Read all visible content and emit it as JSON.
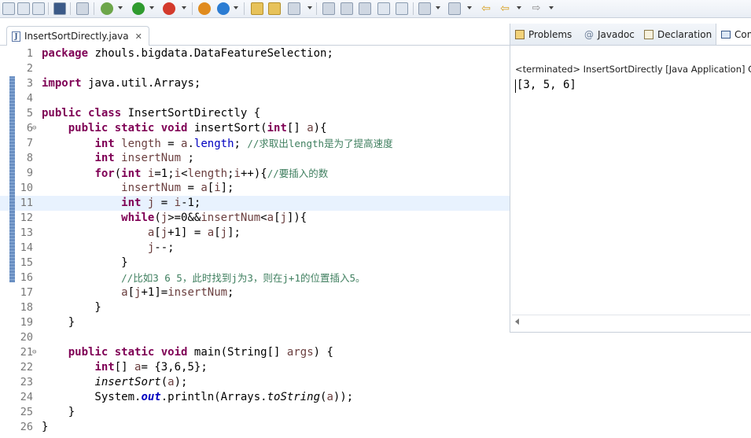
{
  "editor": {
    "tab_label": "InsertSortDirectly.java",
    "lines": [
      {
        "num": "1",
        "tokens": [
          {
            "t": "package",
            "c": "kw"
          },
          {
            "t": " zhouls.bigdata.DataFeatureSelection;"
          }
        ]
      },
      {
        "num": "2",
        "tokens": []
      },
      {
        "num": "3",
        "tokens": [
          {
            "t": "import",
            "c": "kw"
          },
          {
            "t": " java.util.Arrays;"
          }
        ]
      },
      {
        "num": "4",
        "tokens": []
      },
      {
        "num": "5",
        "tokens": [
          {
            "t": "public",
            "c": "kw"
          },
          {
            "t": " "
          },
          {
            "t": "class",
            "c": "kw"
          },
          {
            "t": " InsertSortDirectly {"
          }
        ]
      },
      {
        "num": "6",
        "fold": true,
        "tokens": [
          {
            "t": "    "
          },
          {
            "t": "public",
            "c": "kw"
          },
          {
            "t": " "
          },
          {
            "t": "static",
            "c": "kw"
          },
          {
            "t": " "
          },
          {
            "t": "void",
            "c": "kw"
          },
          {
            "t": " insertSort("
          },
          {
            "t": "int",
            "c": "kw"
          },
          {
            "t": "[] "
          },
          {
            "t": "a",
            "c": "var"
          },
          {
            "t": "){"
          }
        ]
      },
      {
        "num": "7",
        "tokens": [
          {
            "t": "        "
          },
          {
            "t": "int",
            "c": "kw"
          },
          {
            "t": " "
          },
          {
            "t": "length",
            "c": "var"
          },
          {
            "t": " = "
          },
          {
            "t": "a",
            "c": "var"
          },
          {
            "t": "."
          },
          {
            "t": "length",
            "c": "field"
          },
          {
            "t": "; "
          },
          {
            "t": "//求取出length是为了提高速度",
            "c": "cm"
          }
        ]
      },
      {
        "num": "8",
        "tokens": [
          {
            "t": "        "
          },
          {
            "t": "int",
            "c": "kw"
          },
          {
            "t": " "
          },
          {
            "t": "insertNum",
            "c": "var"
          },
          {
            "t": " ;"
          }
        ]
      },
      {
        "num": "9",
        "tokens": [
          {
            "t": "        "
          },
          {
            "t": "for",
            "c": "kw"
          },
          {
            "t": "("
          },
          {
            "t": "int",
            "c": "kw"
          },
          {
            "t": " "
          },
          {
            "t": "i",
            "c": "var"
          },
          {
            "t": "=1;"
          },
          {
            "t": "i",
            "c": "var"
          },
          {
            "t": "<"
          },
          {
            "t": "length",
            "c": "var"
          },
          {
            "t": ";"
          },
          {
            "t": "i",
            "c": "var"
          },
          {
            "t": "++){"
          },
          {
            "t": "//要插入的数",
            "c": "cm"
          }
        ]
      },
      {
        "num": "10",
        "tokens": [
          {
            "t": "            "
          },
          {
            "t": "insertNum",
            "c": "var"
          },
          {
            "t": " = "
          },
          {
            "t": "a",
            "c": "var"
          },
          {
            "t": "["
          },
          {
            "t": "i",
            "c": "var"
          },
          {
            "t": "];"
          }
        ]
      },
      {
        "num": "11",
        "current": true,
        "tokens": [
          {
            "t": "            "
          },
          {
            "t": "int",
            "c": "kw"
          },
          {
            "t": " "
          },
          {
            "t": "j",
            "c": "var"
          },
          {
            "t": " = "
          },
          {
            "t": "i",
            "c": "var"
          },
          {
            "t": "-1;"
          }
        ]
      },
      {
        "num": "12",
        "tokens": [
          {
            "t": "            "
          },
          {
            "t": "while",
            "c": "kw"
          },
          {
            "t": "("
          },
          {
            "t": "j",
            "c": "var"
          },
          {
            "t": ">=0&&"
          },
          {
            "t": "insertNum",
            "c": "var"
          },
          {
            "t": "<"
          },
          {
            "t": "a",
            "c": "var"
          },
          {
            "t": "["
          },
          {
            "t": "j",
            "c": "var"
          },
          {
            "t": "]){"
          }
        ]
      },
      {
        "num": "13",
        "tokens": [
          {
            "t": "                "
          },
          {
            "t": "a",
            "c": "var"
          },
          {
            "t": "["
          },
          {
            "t": "j",
            "c": "var"
          },
          {
            "t": "+1] = "
          },
          {
            "t": "a",
            "c": "var"
          },
          {
            "t": "["
          },
          {
            "t": "j",
            "c": "var"
          },
          {
            "t": "];"
          }
        ]
      },
      {
        "num": "14",
        "tokens": [
          {
            "t": "                "
          },
          {
            "t": "j",
            "c": "var"
          },
          {
            "t": "--;"
          }
        ]
      },
      {
        "num": "15",
        "tokens": [
          {
            "t": "            }"
          }
        ]
      },
      {
        "num": "16",
        "tokens": [
          {
            "t": "            "
          },
          {
            "t": "//比如3 6 5，此时找到j为3，则在j+1的位置插入5。",
            "c": "cm"
          }
        ]
      },
      {
        "num": "17",
        "tokens": [
          {
            "t": "            "
          },
          {
            "t": "a",
            "c": "var"
          },
          {
            "t": "["
          },
          {
            "t": "j",
            "c": "var"
          },
          {
            "t": "+1]="
          },
          {
            "t": "insertNum",
            "c": "var"
          },
          {
            "t": ";"
          }
        ]
      },
      {
        "num": "18",
        "tokens": [
          {
            "t": "        }"
          }
        ]
      },
      {
        "num": "19",
        "tokens": [
          {
            "t": "    }"
          }
        ]
      },
      {
        "num": "20",
        "tokens": []
      },
      {
        "num": "21",
        "fold": true,
        "tokens": [
          {
            "t": "    "
          },
          {
            "t": "public",
            "c": "kw"
          },
          {
            "t": " "
          },
          {
            "t": "static",
            "c": "kw"
          },
          {
            "t": " "
          },
          {
            "t": "void",
            "c": "kw"
          },
          {
            "t": " main(String[] "
          },
          {
            "t": "args",
            "c": "var"
          },
          {
            "t": ") {"
          }
        ]
      },
      {
        "num": "22",
        "tokens": [
          {
            "t": "        "
          },
          {
            "t": "int",
            "c": "kw"
          },
          {
            "t": "[] "
          },
          {
            "t": "a",
            "c": "var"
          },
          {
            "t": "= {3,6,5};"
          }
        ]
      },
      {
        "num": "23",
        "tokens": [
          {
            "t": "        "
          },
          {
            "t": "insertSort",
            "c": "smeth"
          },
          {
            "t": "("
          },
          {
            "t": "a",
            "c": "var"
          },
          {
            "t": ");"
          }
        ]
      },
      {
        "num": "24",
        "tokens": [
          {
            "t": "        System."
          },
          {
            "t": "out",
            "c": "sfield"
          },
          {
            "t": ".println(Arrays."
          },
          {
            "t": "toString",
            "c": "smeth"
          },
          {
            "t": "("
          },
          {
            "t": "a",
            "c": "var"
          },
          {
            "t": "));"
          }
        ]
      },
      {
        "num": "25",
        "tokens": [
          {
            "t": "    }"
          }
        ]
      },
      {
        "num": "26",
        "tokens": [
          {
            "t": "}"
          }
        ]
      }
    ]
  },
  "right_panel": {
    "tabs": [
      {
        "label": "Problems",
        "icon": "problems-icon"
      },
      {
        "label": "Javadoc",
        "icon": "javadoc-icon"
      },
      {
        "label": "Declaration",
        "icon": "declaration-icon"
      },
      {
        "label": "Con",
        "icon": "console-icon"
      }
    ],
    "terminated_text": "<terminated> InsertSortDirectly [Java Application] C",
    "console_output": "[3, 5, 6]"
  },
  "toolbar": {
    "icons": [
      "new-icon",
      "save-icon",
      "save-all-icon",
      "terminal-icon",
      "skip-breakpoints-icon",
      "debug-icon",
      "run-icon",
      "external-tools-icon",
      "new-java-package-icon",
      "new-java-class-icon",
      "open-type-icon",
      "open-task-icon",
      "search-icon",
      "toggle-mark-occurrences-icon",
      "block-selection-icon",
      "show-whitespace-icon",
      "next-annotation-icon",
      "previous-annotation-icon",
      "last-edit-location-icon",
      "back-icon",
      "forward-icon"
    ]
  }
}
